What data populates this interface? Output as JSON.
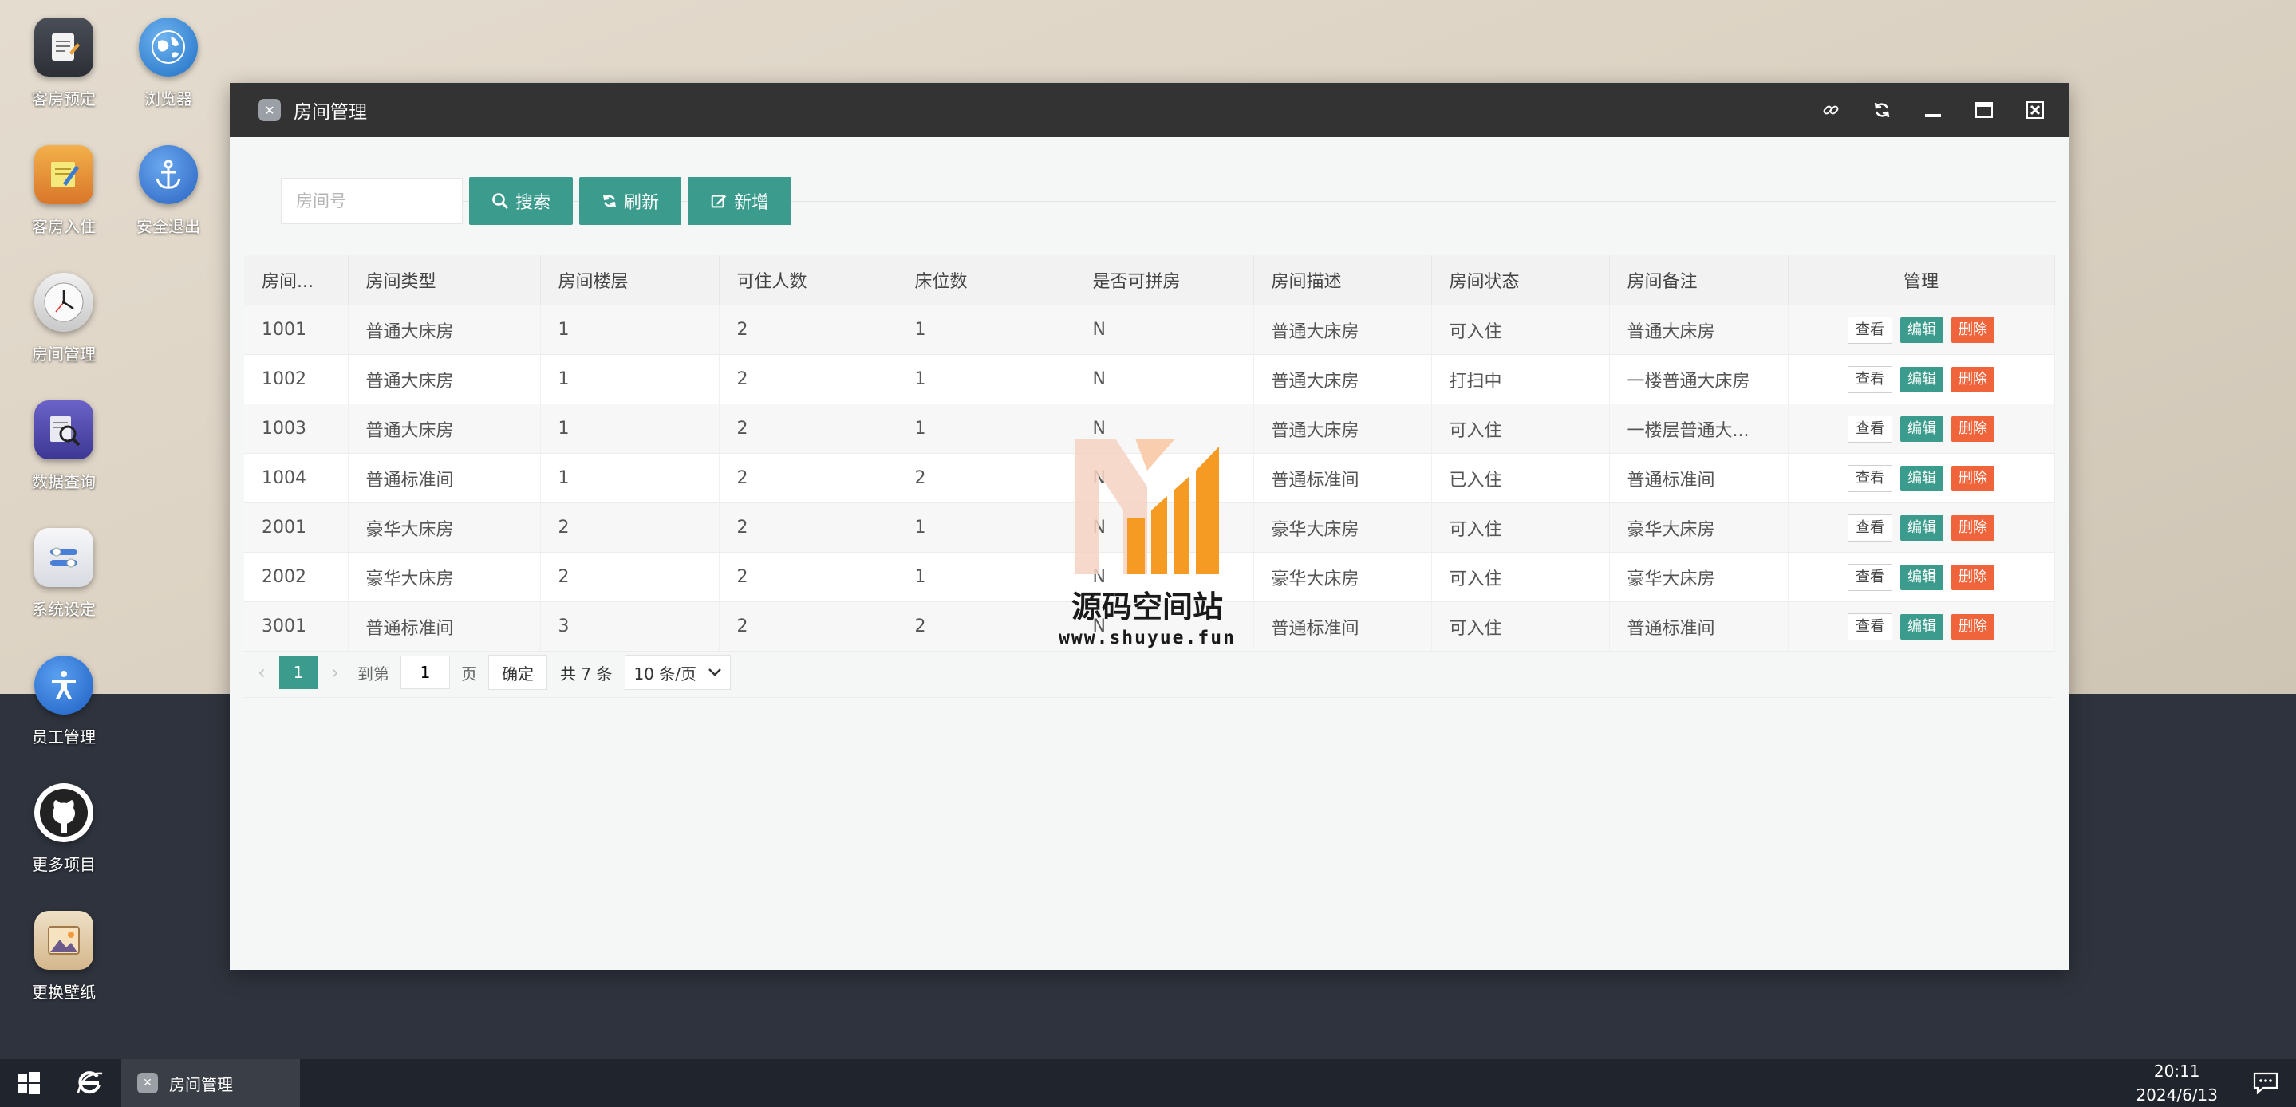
{
  "desktop": {
    "icons": [
      {
        "label": "客房预定",
        "icon": "notepad-icon"
      },
      {
        "label": "浏览器",
        "icon": "globe-icon"
      },
      {
        "label": "客房入住",
        "icon": "pencil-note-icon"
      },
      {
        "label": "安全退出",
        "icon": "anchor-icon"
      },
      {
        "label": "房间管理",
        "icon": "clock-icon"
      },
      {
        "label": "数据查询",
        "icon": "magnifier-icon"
      },
      {
        "label": "系统设定",
        "icon": "toggle-settings-icon"
      },
      {
        "label": "员工管理",
        "icon": "accessibility-icon"
      },
      {
        "label": "更多项目",
        "icon": "github-icon"
      },
      {
        "label": "更换壁纸",
        "icon": "picture-icon"
      }
    ]
  },
  "window": {
    "title": "房间管理",
    "controls": [
      "link-icon",
      "refresh-icon",
      "minimize-icon",
      "maximize-icon",
      "close-icon"
    ]
  },
  "toolbar": {
    "search_placeholder": "房间号",
    "search_label": "搜索",
    "refresh_label": "刷新",
    "add_label": "新增"
  },
  "table": {
    "columns": [
      "房间...",
      "房间类型",
      "房间楼层",
      "可住人数",
      "床位数",
      "是否可拼房",
      "房间描述",
      "房间状态",
      "房间备注",
      "管理"
    ],
    "rows": [
      [
        "1001",
        "普通大床房",
        "1",
        "2",
        "1",
        "N",
        "普通大床房",
        "可入住",
        "普通大床房"
      ],
      [
        "1002",
        "普通大床房",
        "1",
        "2",
        "1",
        "N",
        "普通大床房",
        "打扫中",
        "一楼普通大床房"
      ],
      [
        "1003",
        "普通大床房",
        "1",
        "2",
        "1",
        "N",
        "普通大床房",
        "可入住",
        "一楼层普通大..."
      ],
      [
        "1004",
        "普通标准间",
        "1",
        "2",
        "2",
        "N",
        "普通标准间",
        "已入住",
        "普通标准间"
      ],
      [
        "2001",
        "豪华大床房",
        "2",
        "2",
        "1",
        "N",
        "豪华大床房",
        "可入住",
        "豪华大床房"
      ],
      [
        "2002",
        "豪华大床房",
        "2",
        "2",
        "1",
        "N",
        "豪华大床房",
        "可入住",
        "豪华大床房"
      ],
      [
        "3001",
        "普通标准间",
        "3",
        "2",
        "2",
        "N",
        "普通标准间",
        "可入住",
        "普通标准间"
      ]
    ],
    "actions": {
      "view": "查看",
      "edit": "编辑",
      "delete": "删除"
    }
  },
  "pager": {
    "current_page": "1",
    "goto_label": "到第",
    "goto_value": "1",
    "page_unit": "页",
    "confirm_label": "确定",
    "total_label": "共 7 条",
    "page_size": "10 条/页"
  },
  "watermark": {
    "title": "源码空间站",
    "url": "www.shuyue.fun"
  },
  "taskbar": {
    "task_label": "房间管理",
    "time": "20:11",
    "date": "2024/6/13"
  },
  "colors": {
    "accent": "#3b9c8d",
    "danger": "#f0643c",
    "titlebar": "#333333"
  }
}
